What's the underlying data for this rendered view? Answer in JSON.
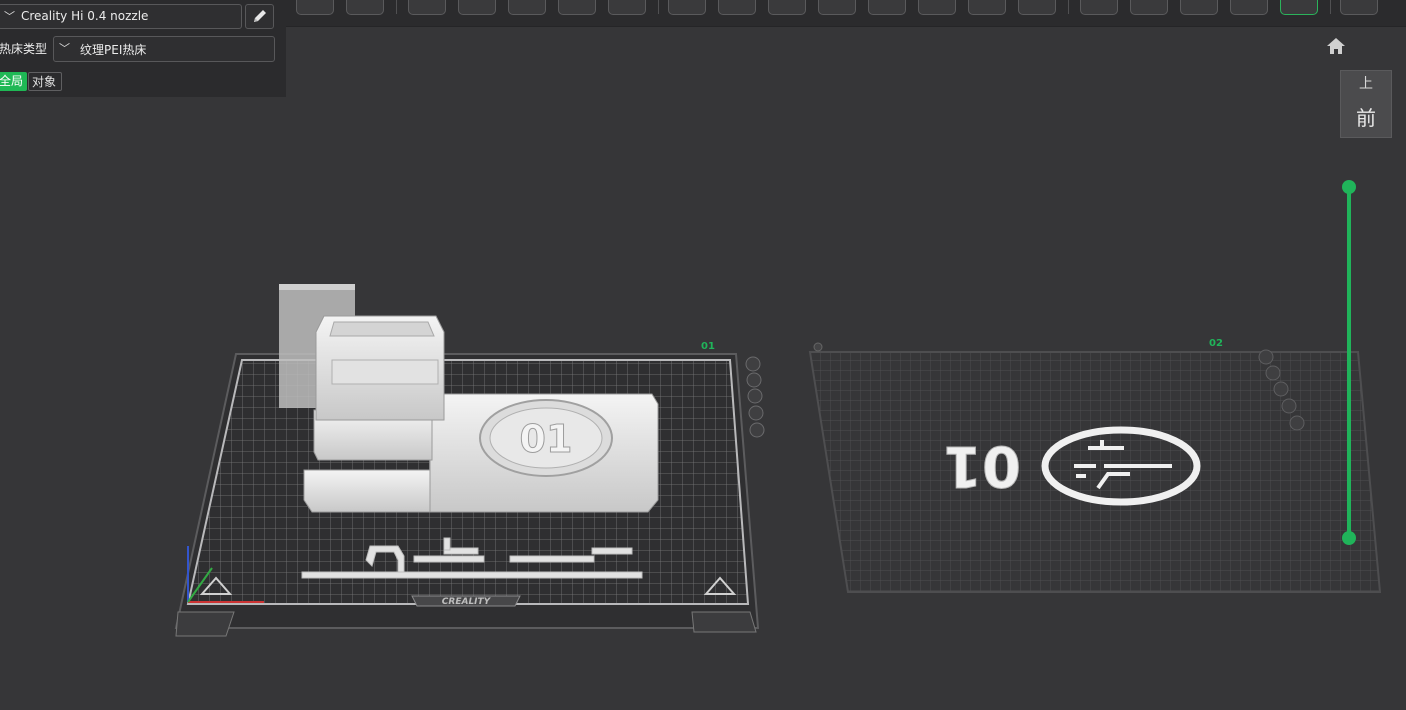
{
  "panel": {
    "printer_preset": "Creality Hi 0.4 nozzle",
    "bed_type_label": "热床类型",
    "bed_type_value": "纹理PEI热床",
    "tabs": [
      {
        "label": "全局",
        "active": true
      },
      {
        "label": "对象",
        "active": false
      }
    ]
  },
  "view_cube": {
    "top_label": "上",
    "front_label": "前"
  },
  "plates": [
    {
      "number": "01",
      "brand": "CREALITY"
    },
    {
      "number": "02"
    }
  ],
  "colors": {
    "accent": "#20b45a",
    "background": "#363638",
    "panel": "#2b2b2d"
  },
  "icons": {
    "nozzle_dropdown": "chevron-down-icon",
    "edit": "pencil-icon",
    "home": "home-icon"
  }
}
